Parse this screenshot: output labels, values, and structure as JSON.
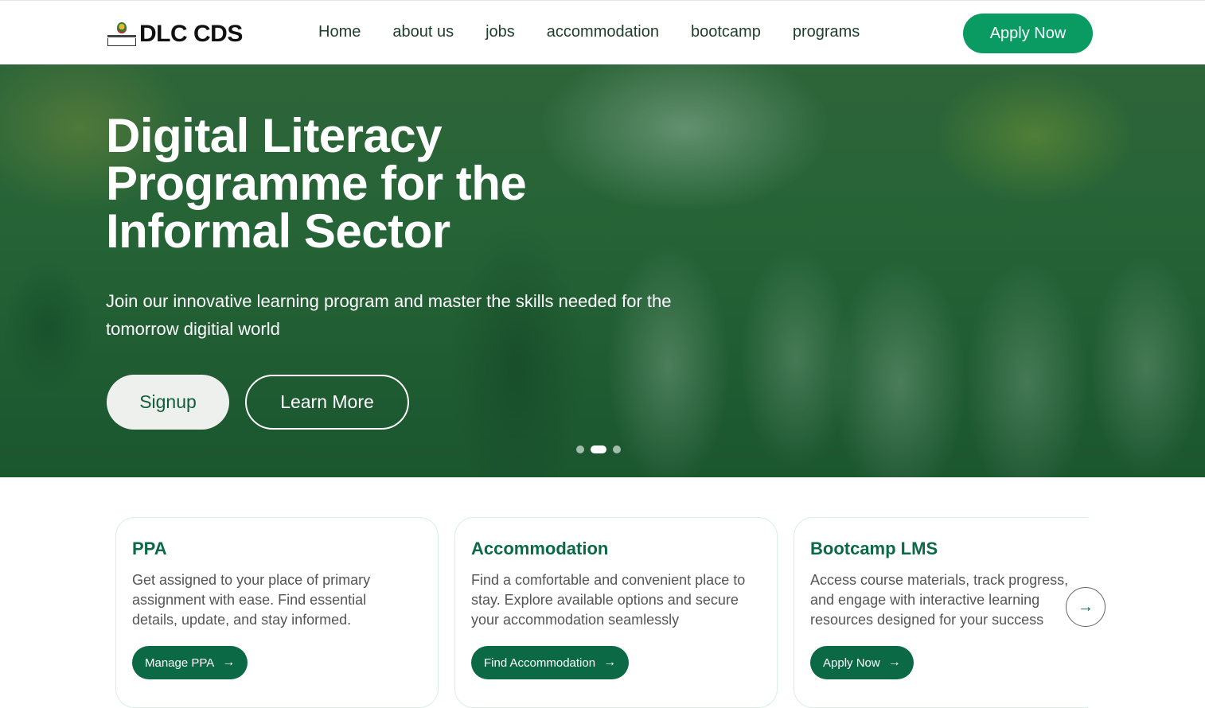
{
  "brand": {
    "name": "DLC CDS"
  },
  "nav": {
    "links": [
      "Home",
      "about us",
      "jobs",
      "accommodation",
      "bootcamp",
      "programs"
    ],
    "apply_label": "Apply Now"
  },
  "hero": {
    "title": "Digital Literacy Programme for the Informal Sector",
    "subtitle": "Join our innovative learning program and master the skills needed for the tomorrow digitial world",
    "signup_label": "Signup",
    "learn_more_label": "Learn More",
    "carousel": {
      "slides": 3,
      "active_index": 1
    }
  },
  "cards": [
    {
      "title": "PPA",
      "text": "Get assigned to your place of primary assignment with ease. Find essential details, update, and stay informed.",
      "button": "Manage PPA"
    },
    {
      "title": "Accommodation",
      "text": "Find a comfortable and convenient place to stay. Explore available options and secure your accommodation seamlessly",
      "button": "Find Accommodation"
    },
    {
      "title": "Bootcamp LMS",
      "text": "Access course materials, track progress, and engage with interactive learning resources designed for your success",
      "button": "Apply Now"
    }
  ],
  "icons": {
    "arrow": "arrow-right-icon",
    "next": "next-arrow-icon"
  },
  "colors": {
    "primary": "#0b6a45",
    "accent": "#0a9b63"
  }
}
